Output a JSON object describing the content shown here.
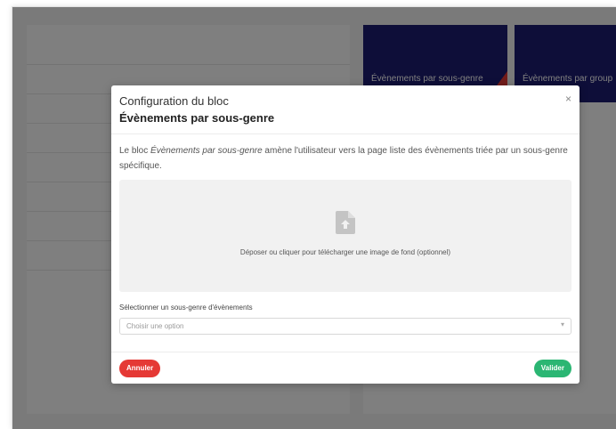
{
  "background": {
    "tiles": [
      {
        "label": "Évènements par sous-genre"
      },
      {
        "label": "Évènements par group"
      }
    ]
  },
  "modal": {
    "kicker": "Configuration du bloc",
    "title": "Évènements par sous-genre",
    "close_icon": "×",
    "description": {
      "prefix": "Le bloc ",
      "block_name": "Évènements par sous-genre",
      "suffix": " amène l'utilisateur vers la page liste des évènements triée par un sous-genre spécifique."
    },
    "dropzone": {
      "icon": "file-upload-icon",
      "text": "Déposer ou cliquer pour télécharger une image de fond (optionnel)"
    },
    "select": {
      "label": "Sélectionner un sous-genre d'évènements",
      "value": "Choisir une option",
      "arrow": "▾"
    },
    "buttons": {
      "cancel": "Annuler",
      "submit": "Valider"
    }
  },
  "colors": {
    "tile": "#1d1d73",
    "danger": "#e53935",
    "success": "#2bb673"
  }
}
